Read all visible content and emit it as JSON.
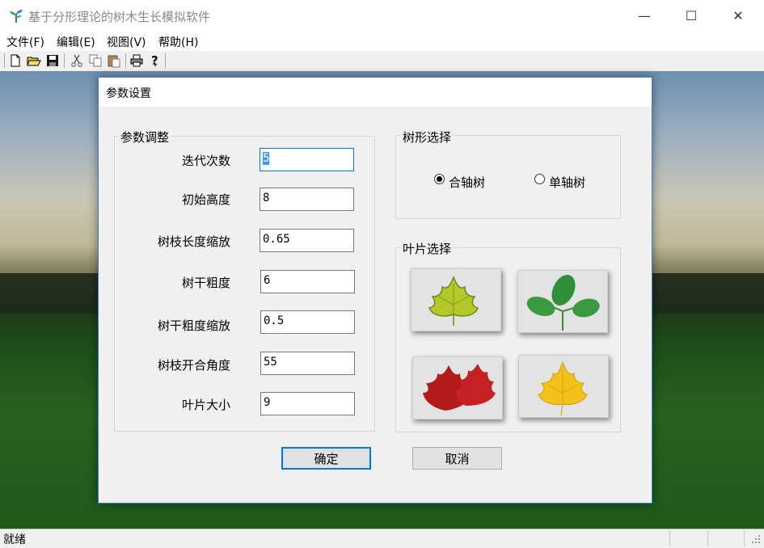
{
  "app": {
    "title": "基于分形理论的树木生长模拟软件",
    "icon": "sprout-icon",
    "controls": {
      "minimize": "—",
      "maximize": "☐",
      "close": "✕"
    }
  },
  "menu": [
    {
      "label": "文件(F)"
    },
    {
      "label": "编辑(E)"
    },
    {
      "label": "视图(V)"
    },
    {
      "label": "帮助(H)"
    }
  ],
  "toolbar": [
    "new-file-icon",
    "open-folder-icon",
    "save-icon",
    "cut-icon",
    "copy-icon",
    "paste-icon",
    "print-icon",
    "help-icon"
  ],
  "status": {
    "text": "就绪"
  },
  "dialog": {
    "title": "参数设置",
    "params_group": {
      "legend": "参数调整",
      "items": [
        {
          "label": "迭代次数",
          "value": "5"
        },
        {
          "label": "初始高度",
          "value": "8"
        },
        {
          "label": "树枝长度缩放",
          "value": "0.65"
        },
        {
          "label": "树干粗度",
          "value": "6"
        },
        {
          "label": "树干粗度缩放",
          "value": "0.5"
        },
        {
          "label": "树枝开合角度",
          "value": "55"
        },
        {
          "label": "叶片大小",
          "value": "9"
        }
      ]
    },
    "tree_group": {
      "legend": "树形选择",
      "options": [
        {
          "label": "合轴树",
          "selected": true
        },
        {
          "label": "单轴树",
          "selected": false
        }
      ]
    },
    "leaf_group": {
      "legend": "叶片选择",
      "leaves": [
        "yellow-green-maple-leaf",
        "green-three-leaf",
        "red-maple-leaf",
        "yellow-maple-leaf"
      ]
    },
    "ok_label": "确定",
    "cancel_label": "取消"
  },
  "colors": {
    "accent": "#0078d7",
    "selection": "#3399ff"
  }
}
